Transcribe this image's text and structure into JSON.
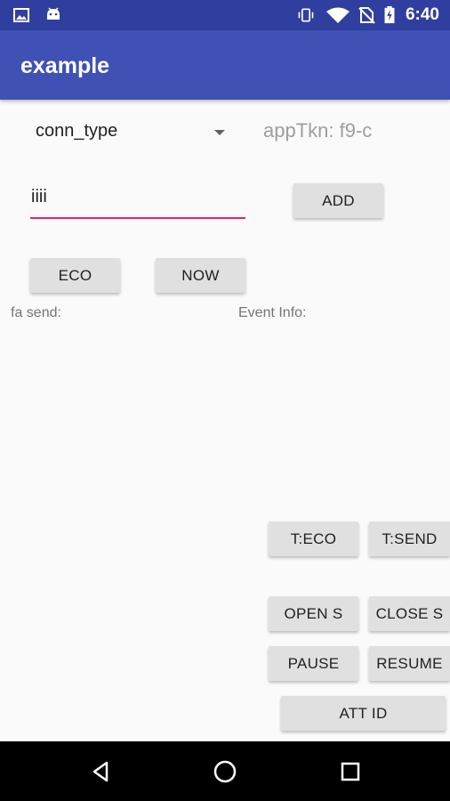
{
  "status_bar": {
    "time": "6:40",
    "icons": [
      "image-icon",
      "android-icon",
      "vibrate-icon",
      "wifi-icon",
      "no-sim-icon",
      "battery-charging-icon"
    ]
  },
  "app_bar": {
    "title": "example"
  },
  "spinner": {
    "selected": "conn_type"
  },
  "app_token": {
    "text": "appTkn: f9-c"
  },
  "input": {
    "value": "iiii"
  },
  "buttons": {
    "add": "ADD",
    "eco": "ECO",
    "now": "NOW",
    "t_eco": "T:ECO",
    "t_send": "T:SEND",
    "open_s": "OPEN S",
    "close_s": "CLOSE S",
    "pause": "PAUSE",
    "resume": "RESUME",
    "att_id": "ATT ID"
  },
  "labels": {
    "fa_send": "fa send:",
    "event_info": "Event Info:"
  },
  "nav_bar": {
    "icons": [
      "back-icon",
      "home-icon",
      "recents-icon"
    ]
  },
  "colors": {
    "primary": "#3f51b5",
    "primary_dark": "#303f9f",
    "accent": "#e91e63",
    "button": "#e0e0e0"
  }
}
